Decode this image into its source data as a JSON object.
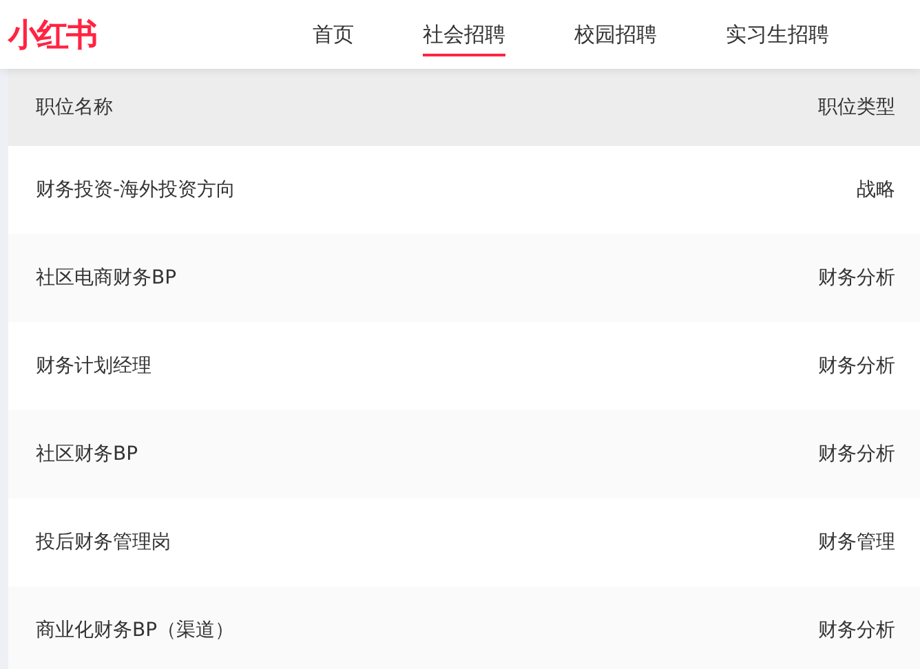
{
  "header": {
    "logo": "小红书",
    "nav": [
      {
        "label": "首页",
        "selected": false
      },
      {
        "label": "社会招聘",
        "selected": true
      },
      {
        "label": "校园招聘",
        "selected": false
      },
      {
        "label": "实习生招聘",
        "selected": false
      }
    ]
  },
  "table": {
    "columns": [
      "职位名称",
      "职位类型"
    ],
    "rows": [
      [
        "财务投资-海外投资方向",
        "战略"
      ],
      [
        "社区电商财务BP",
        "财务分析"
      ],
      [
        "财务计划经理",
        "财务分析"
      ],
      [
        "社区财务BP",
        "财务分析"
      ],
      [
        "投后财务管理岗",
        "财务管理"
      ],
      [
        "商业化财务BP（渠道）",
        "财务分析"
      ]
    ]
  }
}
